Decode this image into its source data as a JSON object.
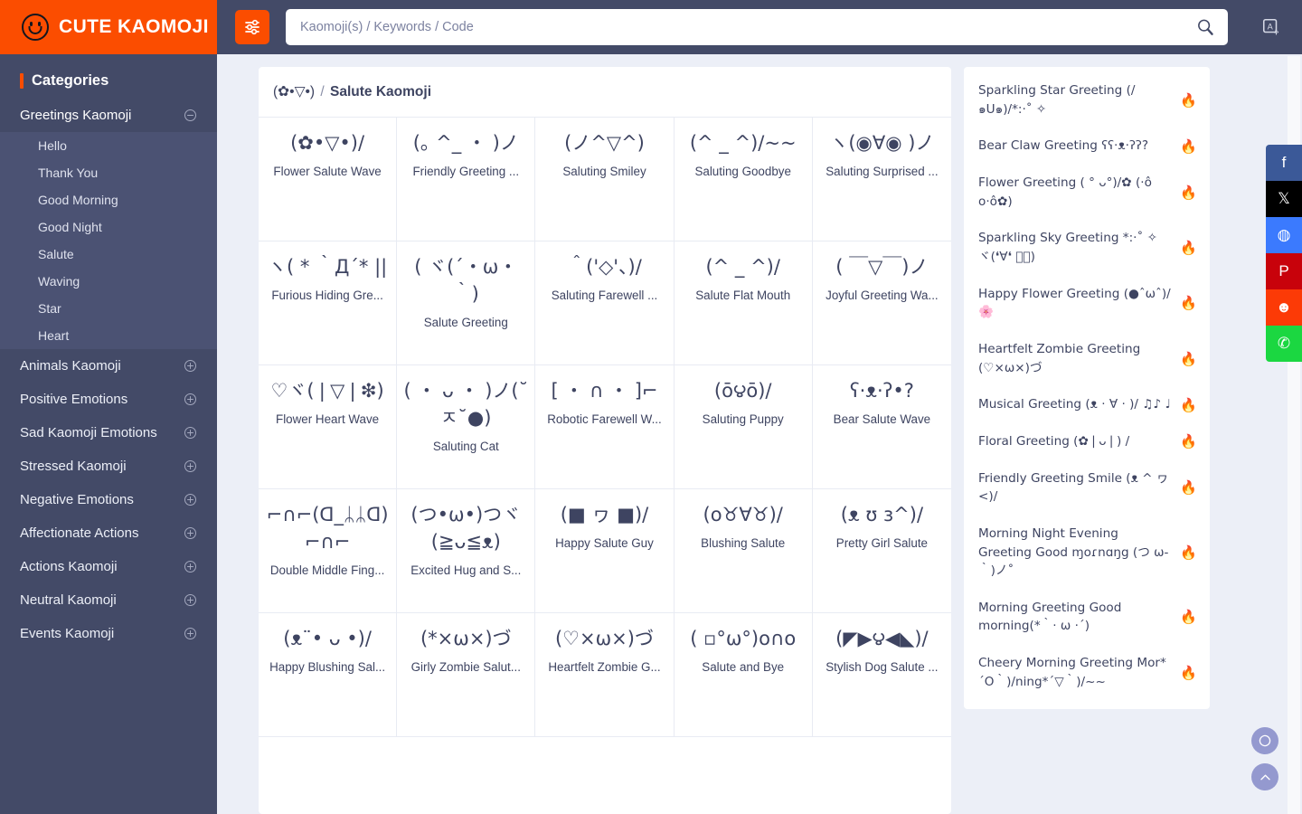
{
  "brand": {
    "title": "CUTE KAOMOJI",
    "logo_icon": "smiley-face-icon"
  },
  "topbar": {
    "filter_icon": "sliders-filter-icon",
    "search_placeholder": "Kaomoji(s) / Keywords / Code",
    "search_value": "",
    "search_icon": "magnifier-icon",
    "language_icon": "translate-icon"
  },
  "sidebar": {
    "heading": "Categories",
    "groups": [
      {
        "label": "Greetings Kaomoji",
        "toggle_icon": "minus-circle-icon",
        "expanded": true,
        "children": [
          {
            "label": "Hello",
            "active": true
          },
          {
            "label": "Thank You",
            "active": true
          },
          {
            "label": "Good Morning",
            "active": true
          },
          {
            "label": "Good Night",
            "active": true
          },
          {
            "label": "Salute",
            "active": true
          },
          {
            "label": "Waving",
            "active": true
          },
          {
            "label": "Star",
            "active": true
          },
          {
            "label": "Heart",
            "active": true
          }
        ]
      },
      {
        "label": "Animals Kaomoji",
        "toggle_icon": "plus-circle-icon",
        "expanded": false,
        "children": []
      },
      {
        "label": "Positive Emotions",
        "toggle_icon": "plus-circle-icon",
        "expanded": false,
        "children": []
      },
      {
        "label": "Sad Kaomoji Emotions",
        "toggle_icon": "plus-circle-icon",
        "expanded": false,
        "children": []
      },
      {
        "label": "Stressed Kaomoji",
        "toggle_icon": "plus-circle-icon",
        "expanded": false,
        "children": []
      },
      {
        "label": "Negative Emotions",
        "toggle_icon": "plus-circle-icon",
        "expanded": false,
        "children": []
      },
      {
        "label": "Affectionate Actions",
        "toggle_icon": "plus-circle-icon",
        "expanded": false,
        "children": []
      },
      {
        "label": "Actions Kaomoji",
        "toggle_icon": "plus-circle-icon",
        "expanded": false,
        "children": []
      },
      {
        "label": "Neutral Kaomoji",
        "toggle_icon": "plus-circle-icon",
        "expanded": false,
        "children": []
      },
      {
        "label": "Events Kaomoji",
        "toggle_icon": "plus-circle-icon",
        "expanded": false,
        "children": []
      }
    ]
  },
  "breadcrumb": {
    "kaomoji": "(✿•▽•)",
    "separator": "/",
    "current": "Salute Kaomoji"
  },
  "grid": {
    "items": [
      {
        "kaomoji": "(✿•▽•)/",
        "name": "Flower Salute Wave"
      },
      {
        "kaomoji": "(｡ ^_ ・ )ノ",
        "name": "Friendly Greeting ..."
      },
      {
        "kaomoji": "(ノ^▽^)",
        "name": "Saluting Smiley"
      },
      {
        "kaomoji": "(^ _ ^)/~~",
        "name": "Saluting Goodbye"
      },
      {
        "kaomoji": "ヽ(◉∀◉   )ノ",
        "name": "Saluting Surprised ..."
      },
      {
        "kaomoji": "ヽ( * ｀Д´* ||",
        "name": "Furious Hiding Gre..."
      },
      {
        "kaomoji": "( ヾ(´・ω・｀)",
        "name": "Salute Greeting"
      },
      {
        "kaomoji": "＾('◇'、)/",
        "name": "Saluting Farewell ..."
      },
      {
        "kaomoji": "(^ _ ^)/",
        "name": "Salute Flat Mouth"
      },
      {
        "kaomoji": "( ￣▽￣)ノ",
        "name": "Joyful Greeting Wa..."
      },
      {
        "kaomoji": "♡ヾ(❘▽❘❇)",
        "name": "Flower Heart Wave"
      },
      {
        "kaomoji": "( ・ ᴗ ・ )ノ(˘ㅈ˘●)",
        "name": "Saluting Cat"
      },
      {
        "kaomoji": "[ ・ ∩ ・ ]⌐",
        "name": "Robotic Farewell W..."
      },
      {
        "kaomoji": "(ō౪ō)/",
        "name": "Saluting Puppy"
      },
      {
        "kaomoji": "ʕ·ᴥ·ʔ•?",
        "name": "Bear Salute Wave"
      },
      {
        "kaomoji": "⌐∩⌐(ᗡ_ᛦᛦᗡ) ⌐∩⌐",
        "name": "Double Middle Fing..."
      },
      {
        "kaomoji": "(つ•ω•)つヾ(≧ᴗ≦ᴥ)",
        "name": "Excited Hug and S..."
      },
      {
        "kaomoji": "(■ ヮ ■)/",
        "name": "Happy Salute Guy"
      },
      {
        "kaomoji": "(o♉∀♉)/",
        "name": "Blushing Salute"
      },
      {
        "kaomoji": "(ᴥ ʊ ɜ^)/",
        "name": "Pretty Girl Salute"
      },
      {
        "kaomoji": "(ᴥ¨•  ᴗ •)/",
        "name": "Happy Blushing Sal..."
      },
      {
        "kaomoji": "(*×ω×)づ",
        "name": "Girly Zombie Salut..."
      },
      {
        "kaomoji": "(♡×ω×)づ",
        "name": "Heartfelt Zombie G..."
      },
      {
        "kaomoji": "( ▫°ω°)o∩o",
        "name": "Salute and Bye"
      },
      {
        "kaomoji": "(◤▶౪◀◣)/",
        "name": "Stylish Dog Salute ..."
      }
    ]
  },
  "trending": {
    "fire_icon": "fire-icon",
    "items": [
      {
        "text": "Sparkling Star Greeting (/ ๑U๑)/*:·˚ ✧"
      },
      {
        "text": "Bear Claw Greeting ʕʕ·ᴥ·ʔʔ?"
      },
      {
        "text": "Flower Greeting ( ° ᴗ°)/✿ (·ô o·ô✿)"
      },
      {
        "text": "Sparkling Sky Greeting *:·˚ ✧ ヾ(❛∀❛ ⌣゙)"
      },
      {
        "text": "Happy Flower Greeting (●ˆωˆ)/🌸"
      },
      {
        "text": "Heartfelt Zombie Greeting (♡×ω×)づ"
      },
      {
        "text": "Musical Greeting (ᴥ · ∀ · )/ ♫♪ ♩"
      },
      {
        "text": "Floral Greeting (✿❘ᴗ❘) /"
      },
      {
        "text": "Friendly Greeting Smile (ᴥ ^ ヮ<)/"
      },
      {
        "text": "Morning Night Evening Greeting Gᴏᴏd ɱoɾnɑŋg (つ ω-｀)ノ˚"
      },
      {
        "text": "Morning Greeting Good morning(*｀· ω ·´)"
      },
      {
        "text": "Cheery Morning Greeting Mor*´Ο｀)/ning*´▽｀)/~~"
      }
    ]
  },
  "social": {
    "items": [
      {
        "name": "facebook",
        "glyph": "f",
        "color": "#3b5998"
      },
      {
        "name": "x-twitter",
        "glyph": "𝕏",
        "color": "#000000"
      },
      {
        "name": "messenger",
        "glyph": "◍",
        "color": "#3b7afe"
      },
      {
        "name": "pinterest",
        "glyph": "P",
        "color": "#c8020b"
      },
      {
        "name": "reddit",
        "glyph": "☻",
        "color": "#fc3a06"
      },
      {
        "name": "whatsapp",
        "glyph": "✆",
        "color": "#1bd741"
      }
    ]
  },
  "float_buttons": [
    {
      "name": "dark-mode-toggle",
      "icon": "moon-icon"
    },
    {
      "name": "scroll-to-top",
      "icon": "chevron-up-icon"
    }
  ]
}
